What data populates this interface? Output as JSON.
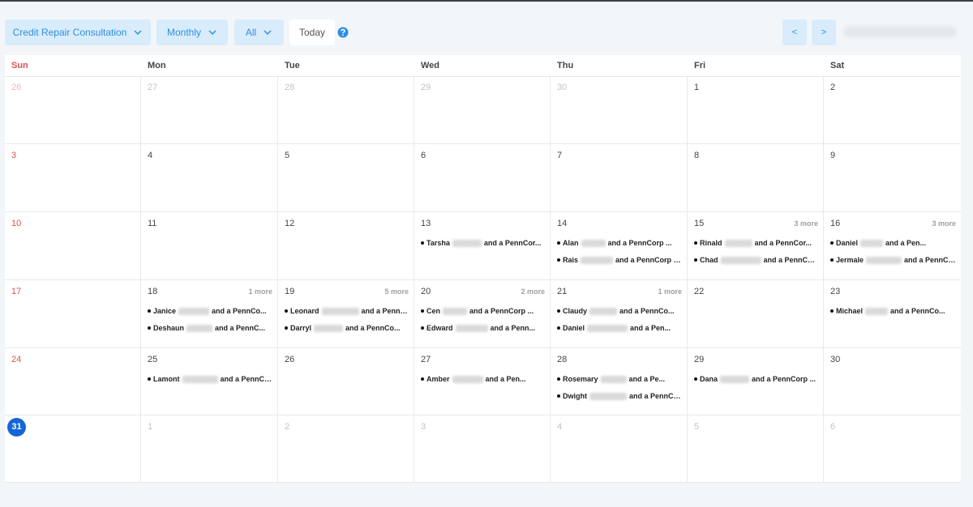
{
  "toolbar": {
    "service_label": "Credit Repair Consultation",
    "view_label": "Monthly",
    "filter_label": "All",
    "today_label": "Today",
    "prev_label": "<",
    "next_label": ">"
  },
  "colors": {
    "accent": "#2d8ee0",
    "button_bg": "#d9ecfb",
    "sunday": "#e05050",
    "today_circle": "#1565d8"
  },
  "weekdays": [
    "Sun",
    "Mon",
    "Tue",
    "Wed",
    "Thu",
    "Fri",
    "Sat"
  ],
  "weeks": [
    [
      {
        "day": "26",
        "other": true
      },
      {
        "day": "27",
        "other": true
      },
      {
        "day": "28",
        "other": true
      },
      {
        "day": "29",
        "other": true
      },
      {
        "day": "30",
        "other": true
      },
      {
        "day": "1"
      },
      {
        "day": "2"
      }
    ],
    [
      {
        "day": "3"
      },
      {
        "day": "4"
      },
      {
        "day": "5"
      },
      {
        "day": "6"
      },
      {
        "day": "7"
      },
      {
        "day": "8"
      },
      {
        "day": "9"
      }
    ],
    [
      {
        "day": "10"
      },
      {
        "day": "11"
      },
      {
        "day": "12"
      },
      {
        "day": "13",
        "events": [
          {
            "name": "Tarsha",
            "tail": "and a PennCor..."
          }
        ]
      },
      {
        "day": "14",
        "events": [
          {
            "name": "Alan",
            "tail": "and a PennCorp ..."
          },
          {
            "name": "Rais",
            "tail": "and a PennCorp Co..."
          }
        ]
      },
      {
        "day": "15",
        "more": "3 more",
        "events": [
          {
            "name": "Rinald",
            "tail": "and a PennCor..."
          },
          {
            "name": "Chad",
            "tail": "and a PennCorp ..."
          }
        ]
      },
      {
        "day": "16",
        "more": "3 more",
        "events": [
          {
            "name": "Daniel",
            "tail": "and a Pen..."
          },
          {
            "name": "Jermale",
            "tail": "and a PennCo..."
          }
        ]
      }
    ],
    [
      {
        "day": "17"
      },
      {
        "day": "18",
        "more": "1 more",
        "events": [
          {
            "name": "Janice",
            "tail": "and a PennCo..."
          },
          {
            "name": "Deshaun",
            "tail": "and a PennC..."
          }
        ]
      },
      {
        "day": "19",
        "more": "5 more",
        "events": [
          {
            "name": "Leonard",
            "tail": "and a PennCo..."
          },
          {
            "name": "Darryl",
            "tail": "and a PennCo..."
          }
        ]
      },
      {
        "day": "20",
        "more": "2 more",
        "events": [
          {
            "name": "Cen",
            "tail": "and a PennCorp ..."
          },
          {
            "name": "Edward",
            "tail": "and a Penn..."
          }
        ]
      },
      {
        "day": "21",
        "more": "1 more",
        "events": [
          {
            "name": "Claudy",
            "tail": "and a PennCo..."
          },
          {
            "name": "Daniel",
            "tail": "and a Pen..."
          }
        ]
      },
      {
        "day": "22"
      },
      {
        "day": "23",
        "events": [
          {
            "name": "Michael",
            "tail": "and a PennCo..."
          }
        ]
      }
    ],
    [
      {
        "day": "24"
      },
      {
        "day": "25",
        "events": [
          {
            "name": "Lamont",
            "tail": "and a PennCo..."
          }
        ]
      },
      {
        "day": "26"
      },
      {
        "day": "27",
        "events": [
          {
            "name": "Amber",
            "tail": "and a Pen..."
          }
        ]
      },
      {
        "day": "28",
        "events": [
          {
            "name": "Rosemary",
            "tail": "and a Pe..."
          },
          {
            "name": "Dwight",
            "tail": "and a PennCorp ..."
          }
        ]
      },
      {
        "day": "29",
        "events": [
          {
            "name": "Dana",
            "tail": "and a PennCorp ..."
          }
        ]
      },
      {
        "day": "30"
      }
    ],
    [
      {
        "day": "31",
        "today": true
      },
      {
        "day": "1",
        "other": true
      },
      {
        "day": "2",
        "other": true
      },
      {
        "day": "3",
        "other": true
      },
      {
        "day": "4",
        "other": true
      },
      {
        "day": "5",
        "other": true
      },
      {
        "day": "6",
        "other": true
      }
    ]
  ]
}
